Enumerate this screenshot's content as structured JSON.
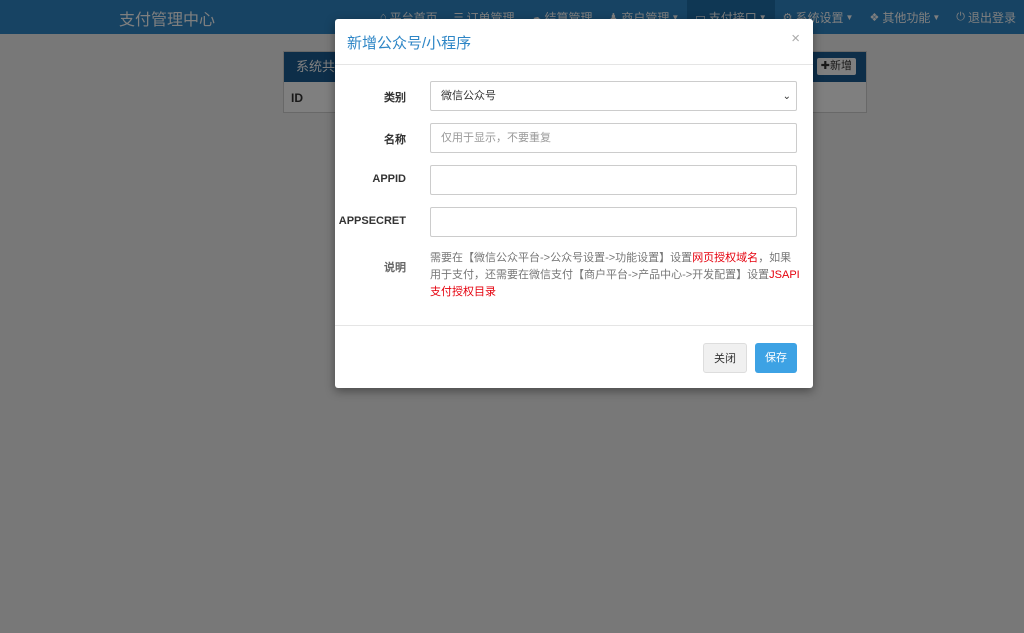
{
  "navbar": {
    "brand": "支付管理中心",
    "items": [
      {
        "label": "平台首页",
        "icon": "home-icon",
        "glyph": "⌂"
      },
      {
        "label": "订单管理",
        "icon": "list-icon",
        "glyph": "☰"
      },
      {
        "label": "结算管理",
        "icon": "cloud-icon",
        "glyph": "☁"
      },
      {
        "label": "商户管理",
        "icon": "user-icon",
        "glyph": "♟"
      },
      {
        "label": "支付接口",
        "icon": "card-icon",
        "glyph": "▭"
      },
      {
        "label": "系统设置",
        "icon": "gear-icon",
        "glyph": "⚙"
      },
      {
        "label": "其他功能",
        "icon": "cube-icon",
        "glyph": "❖"
      },
      {
        "label": "退出登录",
        "icon": "power-icon",
        "glyph": "⏻"
      }
    ]
  },
  "panel": {
    "title": "系统共",
    "add_label": "新增",
    "column_id": "ID"
  },
  "modal": {
    "title": "新增公众号/小程序",
    "close_glyph": "×",
    "fields": {
      "type_label": "类别",
      "type_value": "微信公众号",
      "name_label": "名称",
      "name_placeholder": "仅用于显示，不要重复",
      "appid_label": "APPID",
      "appid_value": "",
      "secret_label": "APPSECRET",
      "secret_value": ""
    },
    "desc_label": "说明",
    "desc": {
      "part1": "需要在【微信公众平台->公众号设置->功能设置】设置",
      "red1": "网页授权域名",
      "part2": "，如果用于支付，还需要在微信支付【商户平台->产品中心->开发配置】设置",
      "red2": "JSAPI支付授权目录"
    },
    "buttons": {
      "close": "关闭",
      "save": "保存"
    }
  }
}
